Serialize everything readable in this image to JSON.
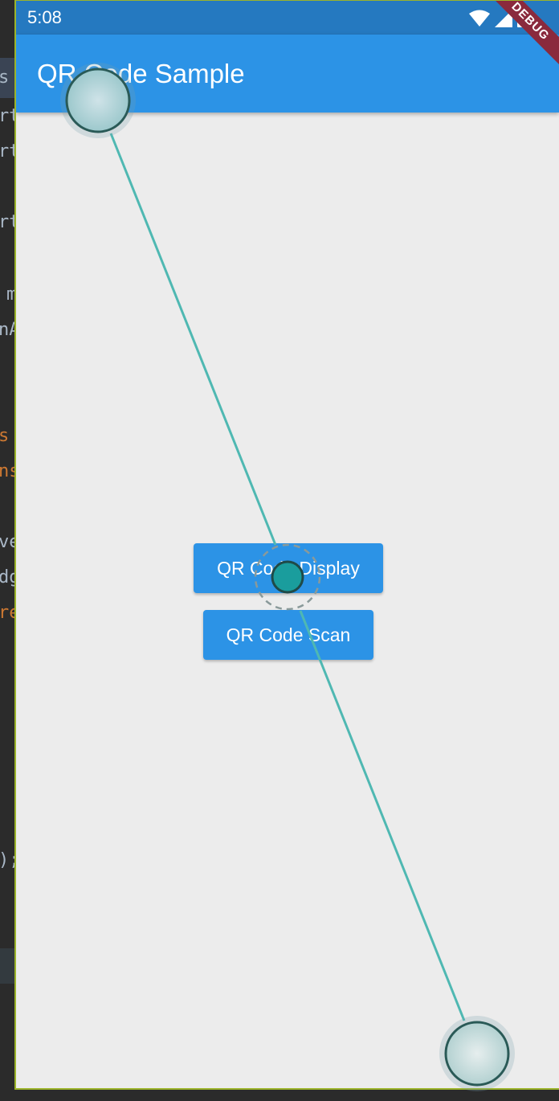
{
  "status_bar": {
    "time": "5:08",
    "icons": [
      "wifi-icon",
      "signal-icon",
      "battery-icon"
    ]
  },
  "app_bar": {
    "title": "QR Code Sample"
  },
  "debug_banner": {
    "label": "DEBUG"
  },
  "buttons": {
    "display_label": "QR Code Display",
    "scan_label": "QR Code Scan"
  },
  "ide_fragments": {
    "f1": "s",
    "f2": "rt",
    "f3": "rt",
    "f4": "rt",
    "f5": "m",
    "f6": "nA",
    "f7": "s",
    "f8": "ns",
    "f9": "ve",
    "f10": "dg",
    "f11": "re",
    "f12": ");"
  },
  "colors": {
    "app_bar": "#2c93e6",
    "status_bar": "#2579c0",
    "button": "#2c93e6",
    "background": "#ececec",
    "gesture_accent": "#1a9d9d"
  }
}
